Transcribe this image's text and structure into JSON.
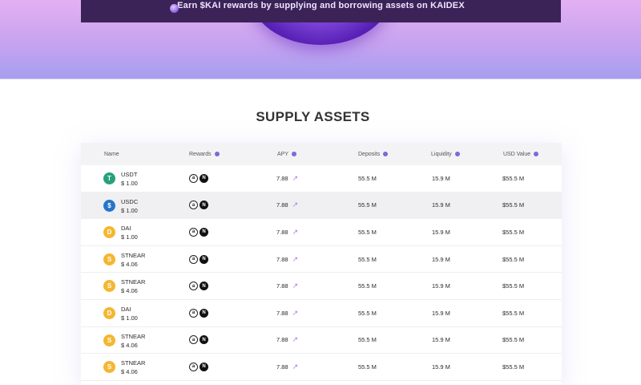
{
  "hero": {
    "banner_text": "Earn $KAI rewards by supplying and borrowing assets on KAIDEX"
  },
  "section_title": "SUPPLY ASSETS",
  "table": {
    "headers": {
      "name": "Name",
      "rewards": "Rewards",
      "apy": "APY",
      "deposits": "Deposits",
      "liquidity": "Liquidity",
      "usd_value": "USD Value"
    },
    "rows": [
      {
        "name": "USDT",
        "price": "$ 1.00",
        "icon": "tether-icon",
        "color": "#26a17b",
        "glyph": "T",
        "apy": "7.88",
        "deposits": "55.5 M",
        "liquidity": "15.9 M",
        "usd_value": "$55.5 M"
      },
      {
        "name": "USDC",
        "price": "$ 1.00",
        "icon": "usdc-icon",
        "color": "#2775ca",
        "glyph": "$",
        "apy": "7.88",
        "deposits": "55.5 M",
        "liquidity": "15.9 M",
        "usd_value": "$55.5 M"
      },
      {
        "name": "DAI",
        "price": "$ 1.00",
        "icon": "dai-icon",
        "color": "#f4b731",
        "glyph": "D",
        "apy": "7.88",
        "deposits": "55.5 M",
        "liquidity": "15.9 M",
        "usd_value": "$55.5 M"
      },
      {
        "name": "STNEAR",
        "price": "$ 4.06",
        "icon": "stnear-icon",
        "color": "#f4b731",
        "glyph": "S",
        "apy": "7.88",
        "deposits": "55.5 M",
        "liquidity": "15.9 M",
        "usd_value": "$55.5 M"
      },
      {
        "name": "STNEAR",
        "price": "$ 4.06",
        "icon": "stnear-icon",
        "color": "#f4b731",
        "glyph": "S",
        "apy": "7.88",
        "deposits": "55.5 M",
        "liquidity": "15.9 M",
        "usd_value": "$55.5 M"
      },
      {
        "name": "DAI",
        "price": "$ 1.00",
        "icon": "dai-icon",
        "color": "#f4b731",
        "glyph": "D",
        "apy": "7.88",
        "deposits": "55.5 M",
        "liquidity": "15.9 M",
        "usd_value": "$55.5 M"
      },
      {
        "name": "STNEAR",
        "price": "$ 4.06",
        "icon": "stnear-icon",
        "color": "#f4b731",
        "glyph": "S",
        "apy": "7.88",
        "deposits": "55.5 M",
        "liquidity": "15.9 M",
        "usd_value": "$55.5 M"
      },
      {
        "name": "STNEAR",
        "price": "$ 4.06",
        "icon": "stnear-icon",
        "color": "#f4b731",
        "glyph": "S",
        "apy": "7.88",
        "deposits": "55.5 M",
        "liquidity": "15.9 M",
        "usd_value": "$55.5 M"
      }
    ]
  },
  "colors": {
    "accent": "#7a6ad8",
    "hero_top": "#e3b0f2",
    "hero_bottom": "#a69ef0",
    "banner": "#3b2358"
  }
}
